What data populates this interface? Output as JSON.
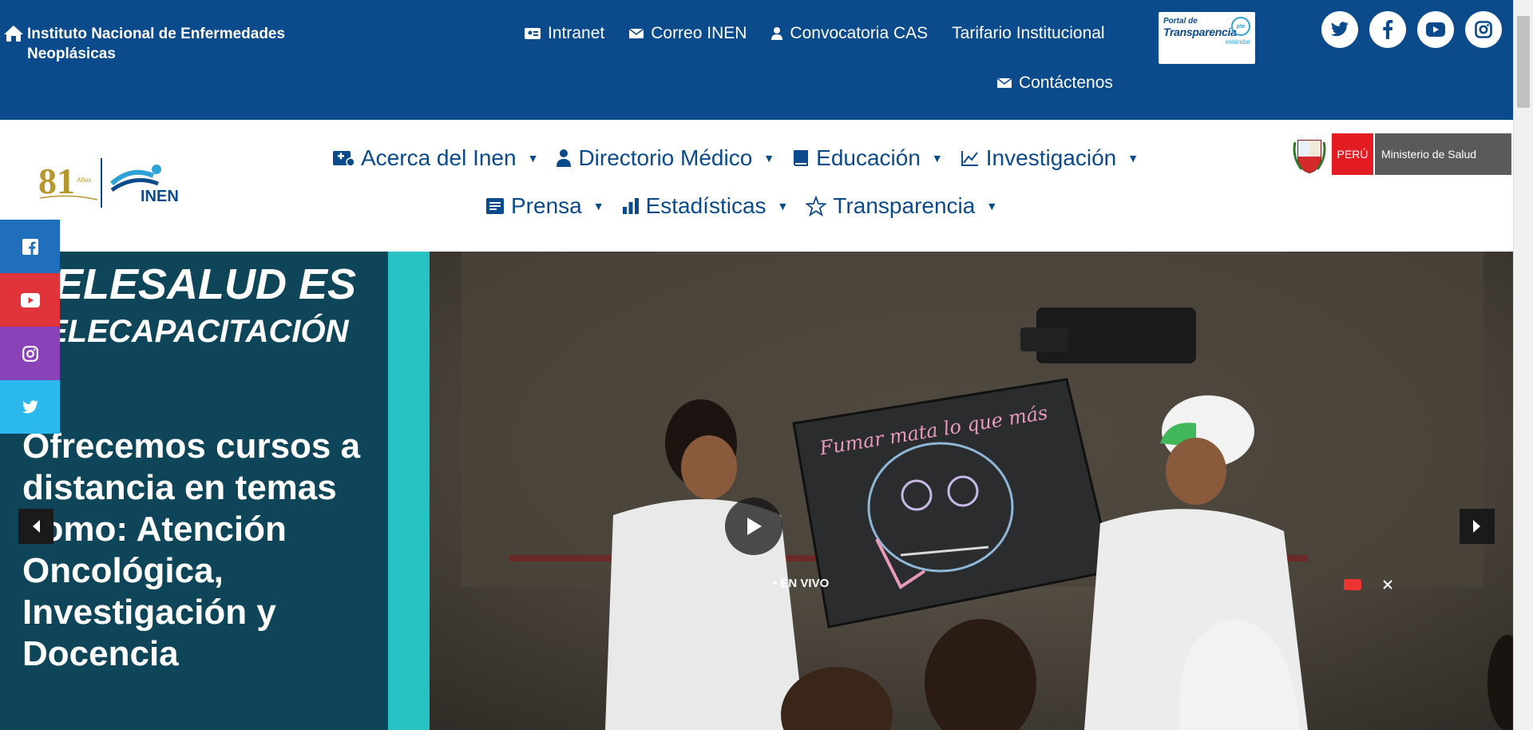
{
  "topbar": {
    "institution_name": "Instituto Nacional de Enfermedades Neoplásicas",
    "links": [
      {
        "label": "Intranet",
        "icon": "intranet-icon"
      },
      {
        "label": "Correo INEN",
        "icon": "mail-icon"
      },
      {
        "label": "Convocatoria CAS",
        "icon": "user-icon"
      },
      {
        "label": "Tarifario Institucional",
        "icon": ""
      }
    ],
    "contact_label": "Contáctenos",
    "transparencia": {
      "line1": "Portal de",
      "line2": "Transparencia",
      "line3": "estándar",
      "badge": "pte"
    },
    "socials": [
      "twitter-icon",
      "facebook-icon",
      "youtube-icon",
      "instagram-icon"
    ]
  },
  "header": {
    "logo_81": {
      "number": "81",
      "text": "Años"
    },
    "logo_inen": "INEN",
    "nav_row1": [
      {
        "label": "Acerca del Inen",
        "icon": "hospital-icon"
      },
      {
        "label": "Directorio Médico",
        "icon": "user-icon"
      },
      {
        "label": "Educación",
        "icon": "book-icon"
      },
      {
        "label": "Investigación",
        "icon": "chart-line-icon"
      }
    ],
    "nav_row2": [
      {
        "label": "Prensa",
        "icon": "newspaper-icon"
      },
      {
        "label": "Estadísticas",
        "icon": "bar-chart-icon"
      },
      {
        "label": "Transparencia",
        "icon": "star-icon"
      }
    ],
    "minsa": {
      "country": "PERÚ",
      "ministry": "Ministerio de Salud"
    }
  },
  "slider": {
    "heading1": "ELESALUD ES",
    "heading2": "ELECAPACITACIÓN",
    "body": "Ofrecemos cursos a distancia en temas como: Atención Oncológica, Investigación y Docencia",
    "board_text": "Fumar mata lo que más",
    "live_text": "• EN VIVO"
  },
  "side_social": [
    "facebook-icon",
    "youtube-icon",
    "instagram-icon",
    "twitter-icon"
  ],
  "colors": {
    "topbar": "#0b4a8b",
    "nav_text": "#0b4a8b",
    "slide_left": "#0e4558",
    "slide_stripe": "#26c2c4",
    "facebook": "#1f6fbd",
    "youtube": "#e0343a",
    "instagram": "#8a42b8",
    "twitter": "#2bb8ec"
  }
}
